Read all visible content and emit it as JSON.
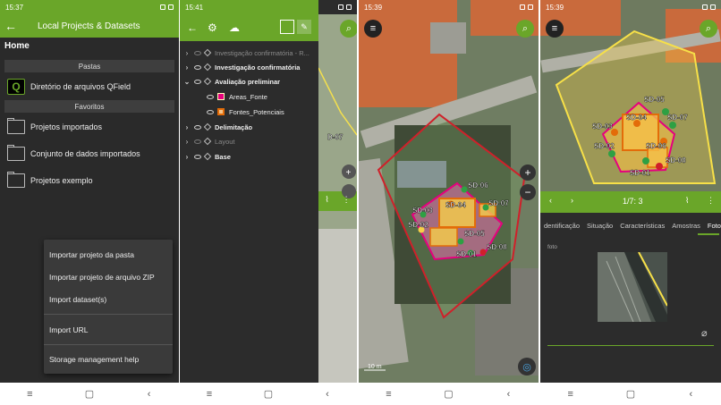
{
  "panel1": {
    "time": "15:37",
    "title": "Local Projects & Datasets",
    "home": "Home",
    "section_pastas": "Pastas",
    "qfield_dir": "Diretório de arquivos QField",
    "section_favoritos": "Favoritos",
    "favorites": [
      "Projetos importados",
      "Conjunto de dados importados",
      "Projetos exemplo"
    ],
    "menu": [
      "Importar projeto da pasta",
      "Importar projeto de arquivo ZIP",
      "Import dataset(s)",
      "Import URL",
      "Storage management help"
    ]
  },
  "panel2": {
    "time": "15:41",
    "layers": [
      {
        "name": "Investigação confirmatória - R...",
        "style": "dim",
        "chev": "›"
      },
      {
        "name": "Investigação confirmatória",
        "style": "bold",
        "chev": "›"
      },
      {
        "name": "Avaliação preliminar",
        "style": "bold",
        "chev": "⌄"
      },
      {
        "name": "Areas_Fonte",
        "style": "child",
        "chev": ""
      },
      {
        "name": "Fontes_Potenciais",
        "style": "child",
        "chev": ""
      },
      {
        "name": "Delimitação",
        "style": "bold",
        "chev": "›"
      },
      {
        "name": "Layout",
        "style": "dim",
        "chev": "›"
      },
      {
        "name": "Base",
        "style": "bold",
        "chev": "›"
      }
    ],
    "symbol_colors": [
      "#e6007e",
      "#e36c09"
    ]
  },
  "panel3": {
    "time": "15:39",
    "scale_label": "10 m",
    "labels": [
      "SD-06",
      "SD-03",
      "SD-04",
      "SD-07",
      "SD-02",
      "SD-05",
      "SD-08",
      "SD-01"
    ]
  },
  "panel4": {
    "time": "15:39",
    "labels": [
      "SD-05",
      "SD-03",
      "SD-04",
      "SD-07",
      "SD-02",
      "SD-06",
      "SD-01",
      "SD-08"
    ],
    "counter": "1/7: 3",
    "tabs": [
      "dentificação",
      "Situação",
      "Características",
      "Amostras",
      "Fotos"
    ],
    "active_tab": "Fotos",
    "foto_label": "foto"
  },
  "colors": {
    "green": "#6aa629",
    "dark": "#2c2c2c"
  }
}
